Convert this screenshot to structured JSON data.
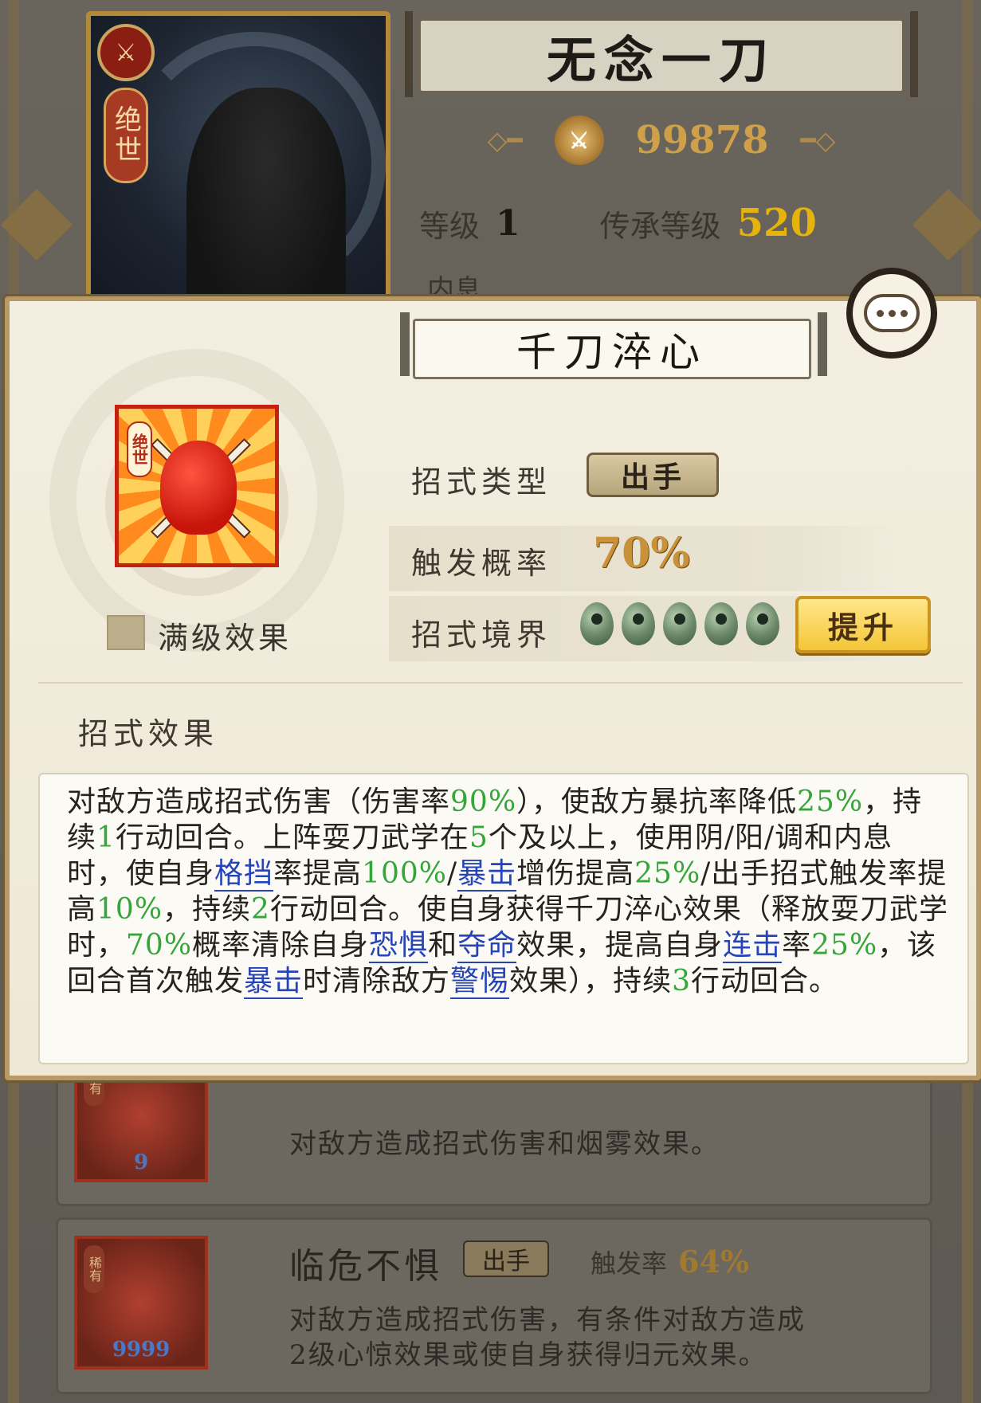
{
  "background": {
    "hero": {
      "rank_glyph": "⚔",
      "rarity": "绝世",
      "name": "无念一刀",
      "power": "99878",
      "level_label": "等级",
      "level_value": "1",
      "inherit_label": "传承等级",
      "inherit_value": "520",
      "peek_text": "内息"
    },
    "move_list": [
      {
        "rarity": "稀有",
        "thumb_level": "9",
        "description": "对敌方造成招式伤害和烟雾效果。"
      },
      {
        "rarity": "稀有",
        "thumb_level": "9999",
        "title": "临危不惧",
        "type": "出手",
        "rate_label": "触发率",
        "rate_value": "64%",
        "description_line1": "对敌方造成招式伤害，有条件对敌方造成",
        "description_line2": "2级心惊效果或使自身获得归元效果。"
      }
    ]
  },
  "popup": {
    "skill_name": "千刀淬心",
    "icon_rarity": "绝世",
    "max_effect_label": "满级效果",
    "attributes": {
      "type_label": "招式类型",
      "type_value": "出手",
      "rate_label": "触发概率",
      "rate_value": "70%",
      "realm_label": "招式境界",
      "realm_orbs": 5,
      "upgrade_label": "提升"
    },
    "effect_heading": "招式效果",
    "effect_segments": [
      {
        "t": "对敌方造成招式伤害（伤害率"
      },
      {
        "t": "90%",
        "s": "g"
      },
      {
        "t": "），使敌方暴抗率降低"
      },
      {
        "t": "25%",
        "s": "g"
      },
      {
        "t": "，持续"
      },
      {
        "t": "1",
        "s": "g"
      },
      {
        "t": "行动回合。上阵耍刀武学在"
      },
      {
        "t": "5",
        "s": "g"
      },
      {
        "t": "个及以上，使用阴/阳/调和内息时，使自身"
      },
      {
        "t": "格挡",
        "s": "k"
      },
      {
        "t": "率提高"
      },
      {
        "t": "100%",
        "s": "g"
      },
      {
        "t": "/"
      },
      {
        "t": "暴击",
        "s": "k"
      },
      {
        "t": "增伤提高"
      },
      {
        "t": "25%",
        "s": "g"
      },
      {
        "t": "/出手招式触发率提高"
      },
      {
        "t": "10%",
        "s": "g"
      },
      {
        "t": "，持续"
      },
      {
        "t": "2",
        "s": "g"
      },
      {
        "t": "行动回合。使自身获得千刀淬心效果（释放耍刀武学时，"
      },
      {
        "t": "70%",
        "s": "g"
      },
      {
        "t": "概率清除自身"
      },
      {
        "t": "恐惧",
        "s": "k"
      },
      {
        "t": "和"
      },
      {
        "t": "夺命",
        "s": "k"
      },
      {
        "t": "效果，提高自身"
      },
      {
        "t": "连击",
        "s": "k"
      },
      {
        "t": "率"
      },
      {
        "t": "25%",
        "s": "g"
      },
      {
        "t": "，该回合首次触发"
      },
      {
        "t": "暴击",
        "s": "k"
      },
      {
        "t": "时清除敌方"
      },
      {
        "t": "警惕",
        "s": "k"
      },
      {
        "t": "效果），持续"
      },
      {
        "t": "3",
        "s": "g"
      },
      {
        "t": "行动回合。"
      }
    ]
  },
  "colors": {
    "green_value": "#34a63a",
    "keyword_blue": "#2544b8",
    "gold": "#e6b20c"
  }
}
